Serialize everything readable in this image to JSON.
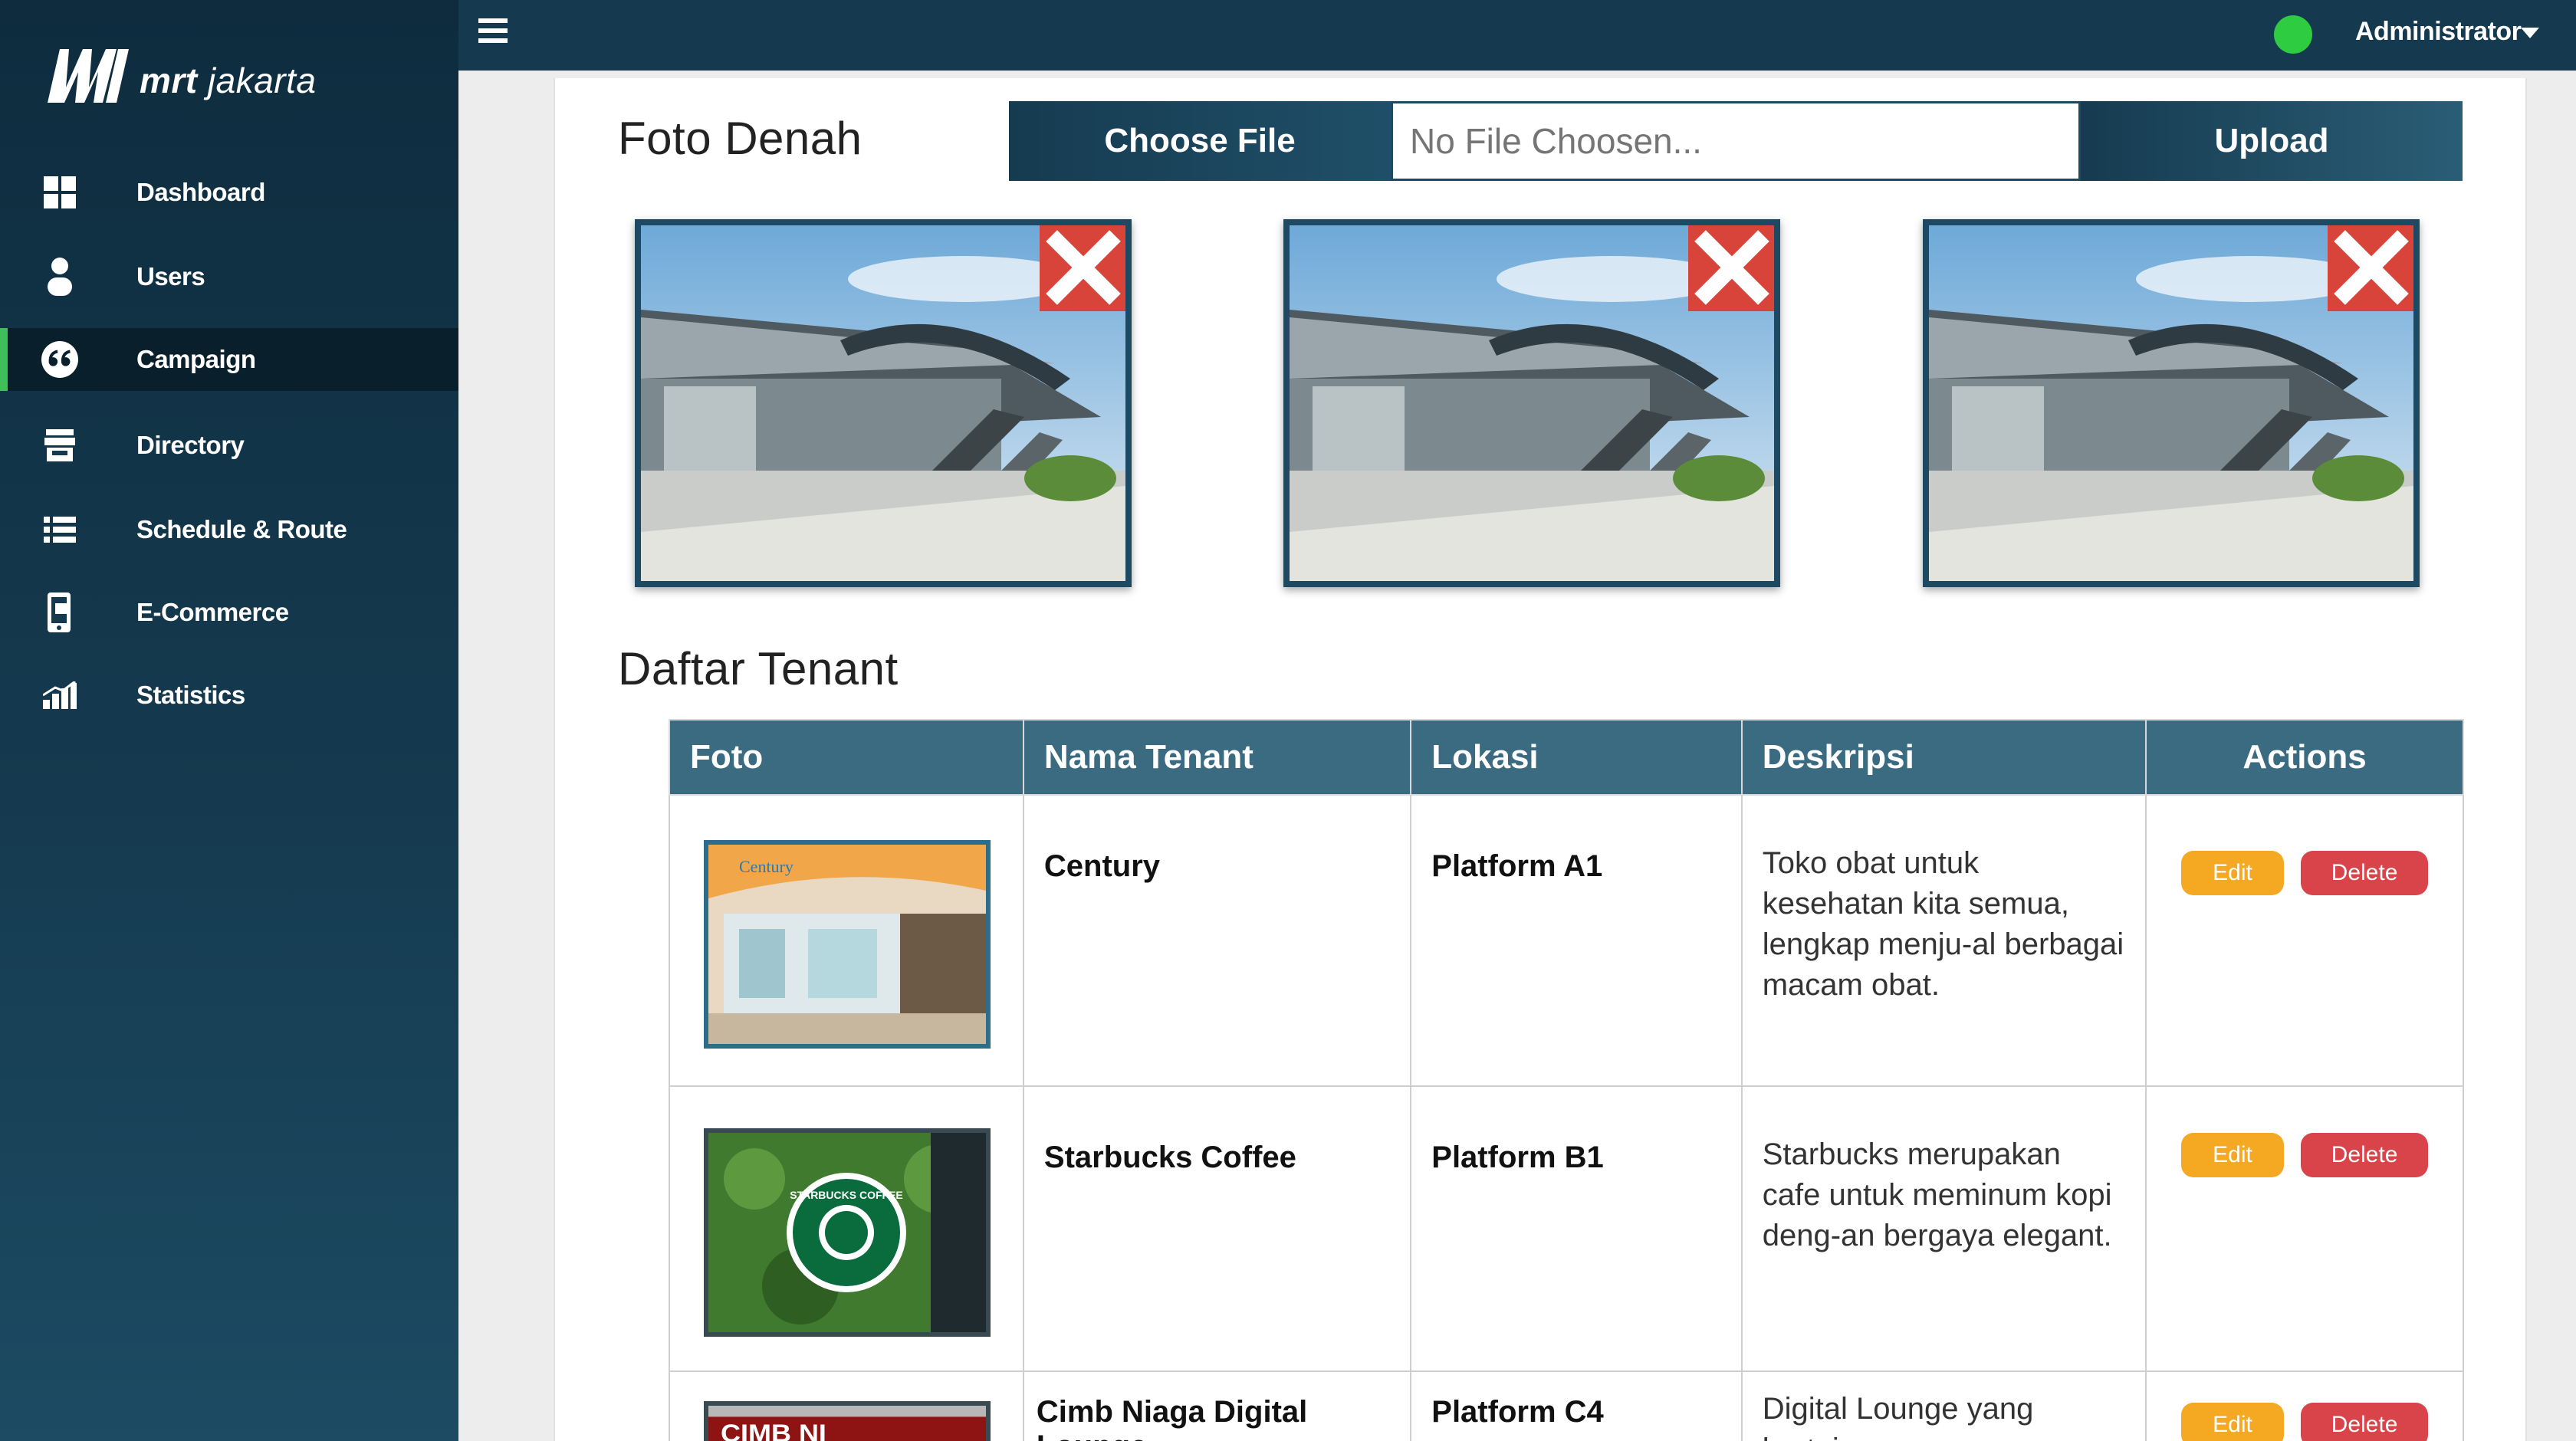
{
  "brand": {
    "logo_text_bold": "mrt",
    "logo_text": " jakarta"
  },
  "sidebar": {
    "items": [
      {
        "label": "Dashboard",
        "icon": "dashboard-icon"
      },
      {
        "label": "Users",
        "icon": "user-icon"
      },
      {
        "label": "Campaign",
        "icon": "quote-icon",
        "active": true
      },
      {
        "label": "Directory",
        "icon": "store-icon"
      },
      {
        "label": "Schedule & Route",
        "icon": "list-icon"
      },
      {
        "label": "E-Commerce",
        "icon": "mobile-cart-icon"
      },
      {
        "label": "Statistics",
        "icon": "bar-chart-icon"
      }
    ]
  },
  "topbar": {
    "user": "Administrator",
    "status_color": "#2ecc40"
  },
  "foto_denah": {
    "title": "Foto Denah",
    "choose_label": "Choose File",
    "file_placeholder": "No File Choosen...",
    "upload_label": "Upload",
    "delete_glyph": "X"
  },
  "daftar_tenant": {
    "title": "Daftar Tenant",
    "columns": [
      "Foto",
      "Nama Tenant",
      "Lokasi",
      "Deskripsi",
      "Actions"
    ],
    "rows": [
      {
        "name": "Century",
        "location": "Platform A1",
        "description": "Toko obat untuk kesehatan kita semua, lengkap menju-al berbagai macam obat.",
        "edit": "Edit",
        "delete": "Delete",
        "photo_text": "Century"
      },
      {
        "name": "Starbucks Coffee",
        "location": "Platform B1",
        "description": "Starbucks merupakan cafe untuk meminum kopi deng-an bergaya elegant.",
        "edit": "Edit",
        "delete": "Delete",
        "photo_text": "STARBUCKS COFFEE"
      },
      {
        "name": "Cimb Niaga Digital Lounge",
        "location": "Platform C4",
        "description": "Digital Lounge yang bertuju",
        "edit": "Edit",
        "delete": "Delete",
        "photo_text": "CIMB NI"
      }
    ]
  },
  "colors": {
    "sidebar": "#153a4f",
    "header": "#3b6b80",
    "active_accent": "#3fbf5c",
    "edit": "#f5a821",
    "delete": "#d9434a"
  }
}
